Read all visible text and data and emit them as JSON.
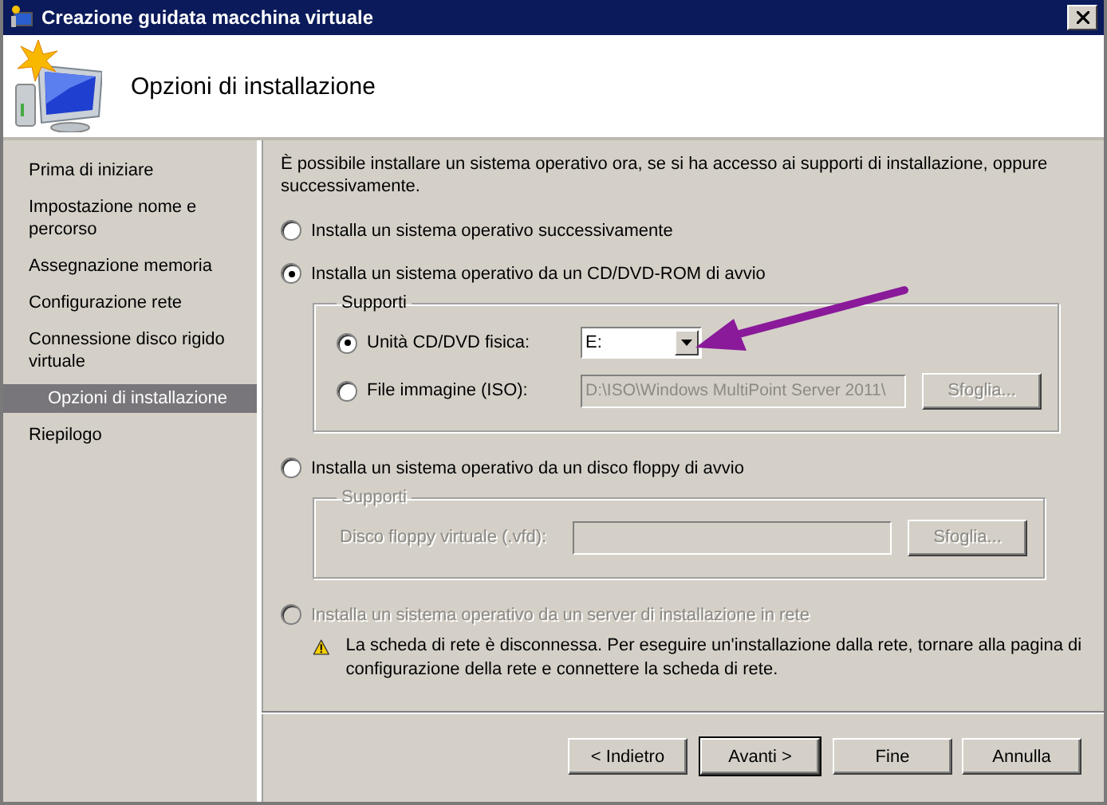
{
  "window": {
    "title": "Creazione guidata macchina virtuale"
  },
  "header": {
    "title": "Opzioni di installazione"
  },
  "sidebar": {
    "items": [
      {
        "label": "Prima di iniziare",
        "selected": false
      },
      {
        "label": "Impostazione nome e percorso",
        "selected": false
      },
      {
        "label": "Assegnazione memoria",
        "selected": false
      },
      {
        "label": "Configurazione rete",
        "selected": false
      },
      {
        "label": "Connessione disco rigido virtuale",
        "selected": false
      },
      {
        "label": "Opzioni di installazione",
        "selected": true
      },
      {
        "label": "Riepilogo",
        "selected": false
      }
    ]
  },
  "intro": "È possibile installare un sistema operativo ora, se si ha accesso ai supporti di installazione, oppure successivamente.",
  "options": [
    {
      "label": "Installa un sistema operativo successivamente",
      "selected": false,
      "disabled": false
    },
    {
      "label": "Installa un sistema operativo da un CD/DVD-ROM di avvio",
      "selected": true,
      "disabled": false,
      "group": {
        "title": "Supporti",
        "rows": [
          {
            "kind": "radio-dropdown",
            "label": "Unità CD/DVD fisica:",
            "selected": true,
            "disabled": false,
            "value": "E:"
          },
          {
            "kind": "radio-file",
            "label": "File immagine (ISO):",
            "selected": false,
            "disabled": true,
            "value": "D:\\ISO\\Windows MultiPoint Server 2011\\",
            "button": "Sfoglia..."
          }
        ]
      }
    },
    {
      "label": "Installa un sistema operativo da un disco floppy di avvio",
      "selected": false,
      "disabled": false,
      "group": {
        "title": "Supporti",
        "rows": [
          {
            "kind": "file",
            "label": "Disco floppy virtuale (.vfd):",
            "disabled": true,
            "button": "Sfoglia..."
          }
        ]
      }
    },
    {
      "label": "Installa un sistema operativo da un server di installazione in rete",
      "selected": false,
      "disabled": true,
      "warning": "La scheda di rete è disconnessa. Per eseguire un'installazione dalla rete, tornare alla pagina di configurazione della rete e connettere la scheda di rete."
    }
  ],
  "buttons": [
    {
      "label": "< Indietro",
      "default": false
    },
    {
      "label": "Avanti >",
      "default": true
    },
    {
      "label": "Fine",
      "default": false
    },
    {
      "label": "Annulla",
      "default": false
    }
  ]
}
